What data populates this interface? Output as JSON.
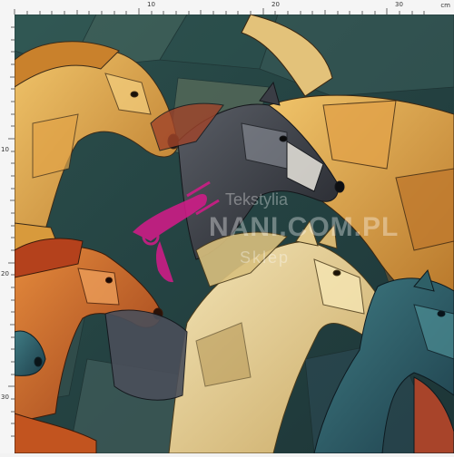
{
  "ruler": {
    "unit_label": "cm",
    "top_ticks": [
      "10",
      "20",
      "30"
    ],
    "left_ticks": [
      "10",
      "20",
      "30"
    ]
  },
  "watermark": {
    "line1": "Tekstylia",
    "line2": "NANI.COM.PL",
    "line3": "Sklep"
  },
  "colors": {
    "background_teal": "#2f5f5a",
    "gold": "#d69a36",
    "orange": "#c8682a",
    "cream": "#e8d39a",
    "dark_horse": "#3d3d3f",
    "magenta_logo": "#d61a8a"
  }
}
